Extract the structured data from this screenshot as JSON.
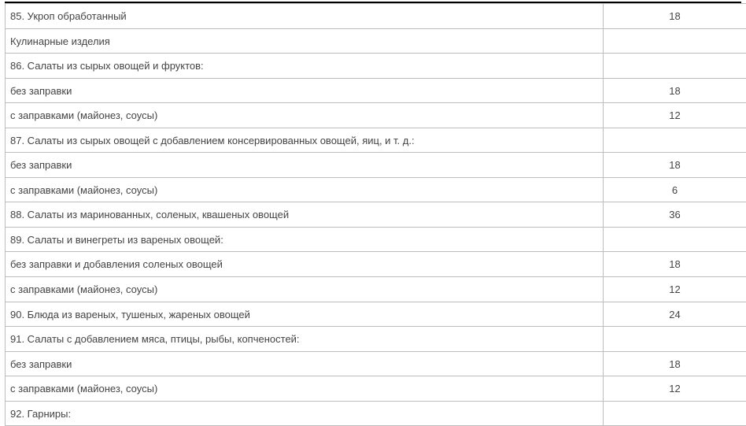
{
  "rows": [
    {
      "name": "85. Укроп обработанный",
      "hours": "18",
      "mark": "-«-"
    },
    {
      "name": "Кулинарные изделия",
      "hours": "",
      "mark": ""
    },
    {
      "name": "86. Салаты из сырых овощей и фруктов:",
      "hours": "",
      "mark": ""
    },
    {
      "name": "без заправки",
      "hours": "18",
      "mark": "-«-"
    },
    {
      "name": "с заправками (майонез, соусы)",
      "hours": "12",
      "mark": "-«-"
    },
    {
      "name": "87. Салаты из сырых овощей с добавлением консервированных овощей, яиц, и т. д.:",
      "hours": "",
      "mark": ""
    },
    {
      "name": "без заправки",
      "hours": "18",
      "mark": "-«-"
    },
    {
      "name": "с заправками (майонез, соусы)",
      "hours": "6",
      "mark": "-«-"
    },
    {
      "name": "88. Салаты из маринованных, соленых, квашеных овощей",
      "hours": "36",
      "mark": "-«-"
    },
    {
      "name": "89. Салаты и винегреты из вареных овощей:",
      "hours": "",
      "mark": ""
    },
    {
      "name": "без заправки и добавления соленых овощей",
      "hours": "18",
      "mark": "-«-"
    },
    {
      "name": "с заправками (майонез, соусы)",
      "hours": "12",
      "mark": "-«-"
    },
    {
      "name": "90. Блюда из вареных, тушеных, жареных овощей",
      "hours": "24",
      "mark": "-«-"
    },
    {
      "name": "91. Салаты с добавлением мяса, птицы, рыбы, копченостей:",
      "hours": "",
      "mark": ""
    },
    {
      "name": "без заправки",
      "hours": "18",
      "mark": "-«-"
    },
    {
      "name": "с заправками (майонез, соусы)",
      "hours": "12",
      "mark": "-«-"
    },
    {
      "name": "92. Гарниры:",
      "hours": "",
      "mark": ""
    }
  ]
}
